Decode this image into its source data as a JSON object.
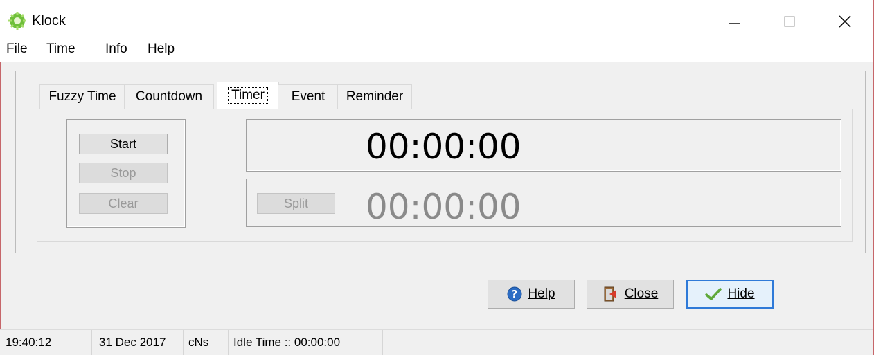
{
  "window": {
    "title": "Klock"
  },
  "menu": [
    "File",
    "Time",
    "Info",
    "Help"
  ],
  "tabs": [
    "Fuzzy Time",
    "Countdown",
    "Timer",
    "Event",
    "Reminder"
  ],
  "active_tab": "Timer",
  "timer": {
    "buttons": {
      "start": "Start",
      "stop": "Stop",
      "clear": "Clear",
      "split": "Split"
    },
    "main_time": "00:00:00",
    "split_time": "00:00:00"
  },
  "dialog_buttons": {
    "help": "Help",
    "close": "Close",
    "hide": "Hide"
  },
  "status": {
    "time": "19:40:12",
    "date": "31 Dec 2017",
    "mode": "cNs",
    "idle": "Idle Time :: 00:00:00"
  },
  "colors": {
    "window_border": "#c6666a",
    "default_button_border": "#2f7ad8",
    "disabled_text": "#9a9a9a"
  }
}
